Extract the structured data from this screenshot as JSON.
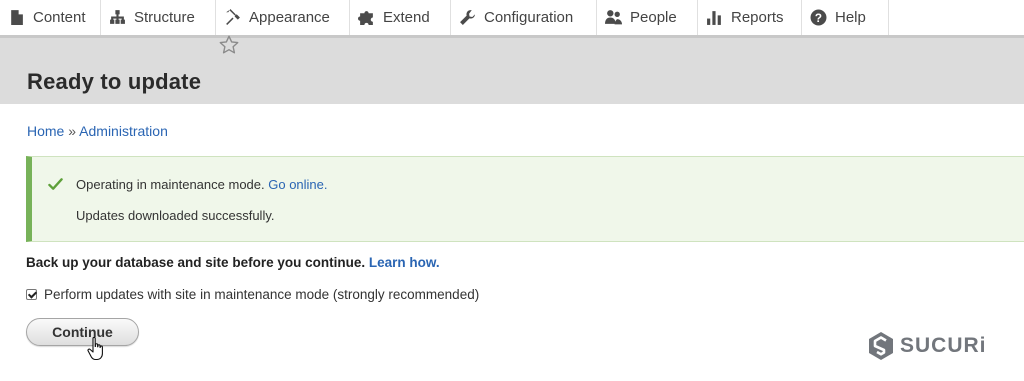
{
  "toolbar": {
    "items": [
      {
        "label": "Content",
        "icon": "content-icon"
      },
      {
        "label": "Structure",
        "icon": "structure-icon"
      },
      {
        "label": "Appearance",
        "icon": "appearance-icon"
      },
      {
        "label": "Extend",
        "icon": "extend-icon"
      },
      {
        "label": "Configuration",
        "icon": "configuration-icon"
      },
      {
        "label": "People",
        "icon": "people-icon"
      },
      {
        "label": "Reports",
        "icon": "reports-icon"
      },
      {
        "label": "Help",
        "icon": "help-icon"
      }
    ]
  },
  "page": {
    "title": "Ready to update",
    "star_icon": "star-outline-icon"
  },
  "breadcrumb": {
    "home": "Home",
    "separator": "»",
    "admin": "Administration"
  },
  "status": {
    "line1_text": "Operating in maintenance mode.",
    "line1_link": "Go online.",
    "line2_text": "Updates downloaded successfully.",
    "accent_color": "#77b259",
    "background_color": "#f0f7ea"
  },
  "notice": {
    "text": "Back up your database and site before you continue.",
    "link": "Learn how."
  },
  "maintenance_checkbox": {
    "label": "Perform updates with site in maintenance mode (strongly recommended)",
    "checked": true
  },
  "continue_button": {
    "label": "Continue"
  },
  "watermark": {
    "text": "SUCURi"
  },
  "colors": {
    "link": "#2a65b3",
    "header_bg": "#dcdcdc"
  }
}
